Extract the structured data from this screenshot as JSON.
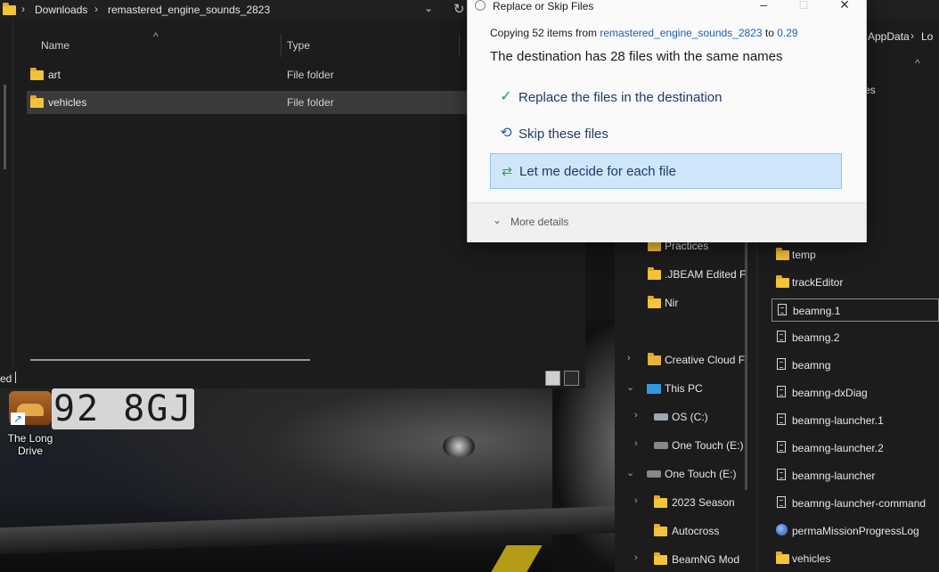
{
  "left_window": {
    "breadcrumb": [
      "Downloads",
      "remastered_engine_sounds_2823"
    ],
    "columns": {
      "name": "Name",
      "type": "Type"
    },
    "rows": [
      {
        "name": "art",
        "type": "File folder",
        "selected": false
      },
      {
        "name": "vehicles",
        "type": "File folder",
        "selected": true
      }
    ],
    "status_text": "ed"
  },
  "desktop": {
    "shortcut_label": "The Long Drive",
    "plate_text": "92 8GJ"
  },
  "dialog": {
    "title": "Replace or Skip Files",
    "copying_prefix": "Copying 52 items from",
    "source": "remastered_engine_sounds_2823",
    "copying_to": "to",
    "destination": "0.29",
    "message": "The destination has 28 files with the same names",
    "options": [
      {
        "label": "Replace the files in the destination",
        "icon": "check-icon",
        "highlighted": false
      },
      {
        "label": "Skip these files",
        "icon": "undo-icon",
        "highlighted": false
      },
      {
        "label": "Let me decide for each file",
        "icon": "compare-icon",
        "highlighted": true
      }
    ],
    "more_details": "More details"
  },
  "right_window": {
    "breadcrumb": [
      "AppData",
      "Lo"
    ],
    "partial_item": "es",
    "nav_items": [
      {
        "label": "Practices"
      },
      {
        "label": ".JBEAM Edited F"
      },
      {
        "label": "Nir"
      },
      {
        "label": "Creative Cloud F"
      },
      {
        "label": "This PC"
      },
      {
        "label": "OS (C:)"
      },
      {
        "label": "One Touch (E:)"
      },
      {
        "label": "One Touch (E:)"
      },
      {
        "label": "2023 Season"
      },
      {
        "label": "Autocross"
      },
      {
        "label": "BeamNG Mod"
      }
    ],
    "files": [
      {
        "name": "temp",
        "kind": "folder"
      },
      {
        "name": "trackEditor",
        "kind": "folder"
      },
      {
        "name": "beamng.1",
        "kind": "file"
      },
      {
        "name": "beamng.2",
        "kind": "file"
      },
      {
        "name": "beamng",
        "kind": "file"
      },
      {
        "name": "beamng-dxDiag",
        "kind": "file"
      },
      {
        "name": "beamng-launcher.1",
        "kind": "file"
      },
      {
        "name": "beamng-launcher.2",
        "kind": "file"
      },
      {
        "name": "beamng-launcher",
        "kind": "file"
      },
      {
        "name": "beamng-launcher-command",
        "kind": "file"
      },
      {
        "name": "permaMissionProgressLog",
        "kind": "file"
      },
      {
        "name": "vehicles",
        "kind": "folder"
      }
    ]
  },
  "colors": {
    "accent": "#1a5fb4",
    "selection": "#cfe6fa",
    "folder": "#f2c33b",
    "check": "#2e9b48"
  }
}
